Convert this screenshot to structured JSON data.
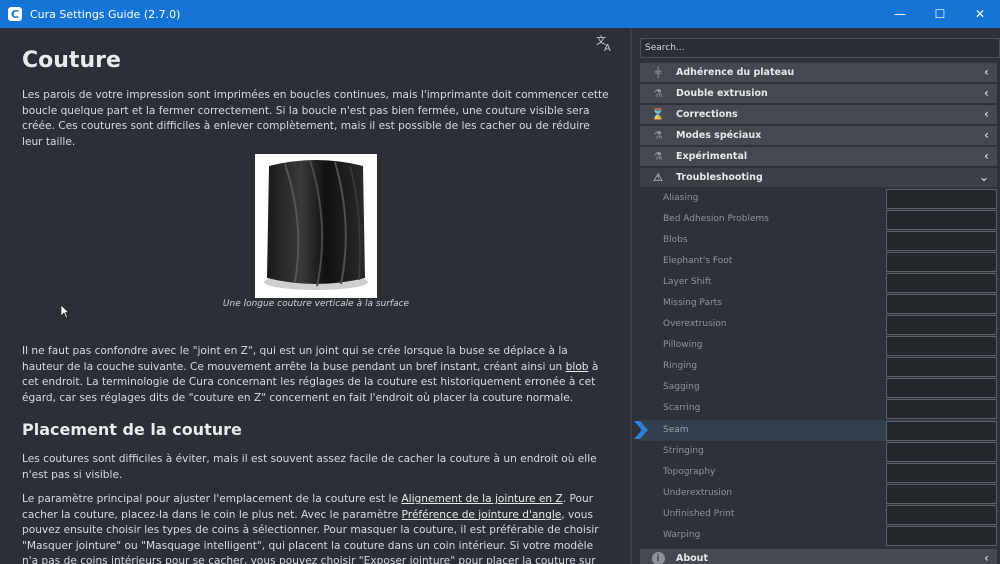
{
  "window": {
    "title": "Cura Settings Guide (2.7.0)",
    "app_icon_glyph": "C",
    "controls": {
      "minimize": "—",
      "maximize": "☐",
      "close": "✕"
    }
  },
  "article": {
    "heading": "Couture",
    "intro": "Les parois de votre impression sont imprimées en boucles continues, mais l'imprimante doit commencer cette boucle quelque part et la fermer correctement. Si la boucle n'est pas bien fermée, une couture visible sera créée. Ces coutures sont difficiles à enlever complètement, mais il est possible de les cacher ou de réduire leur taille.",
    "figure_caption": "Une longue couture verticale à la surface",
    "p2_before": "Il ne faut pas confondre avec le \"joint en Z\", qui est un joint qui se crée lorsque la buse se déplace à la hauteur de la couche suivante. Ce mouvement arrête la buse pendant un bref instant, créant ainsi un ",
    "p2_link": "blob",
    "p2_after": " à cet endroit. La terminologie de Cura concernant les réglages de la couture est historiquement erronée à cet égard, car ses réglages dits de \"couture en Z\" concernent en fait l'endroit où placer la couture normale.",
    "subheading": "Placement de la couture",
    "p3": "Les coutures sont difficiles à éviter, mais il est souvent assez facile de cacher la couture à un endroit où elle n'est pas si visible.",
    "p4_a": "Le paramètre principal pour ajuster l'emplacement de la couture est le ",
    "p4_link1": "Alignement de la jointure en Z",
    "p4_b": ". Pour cacher la couture, placez-la dans le coin le plus net. Avec le paramètre ",
    "p4_link2": "Préférence de jointure d'angle",
    "p4_c": ", vous pouvez ensuite choisir les types de coins à sélectionner. Pour masquer la couture, il est préférable de choisir \"Masquer jointure\" ou \"Masquage intelligent\", qui placent la couture dans un coin intérieur. Si votre modèle n'a pas de coins intérieurs pour se cacher, vous pouvez choisir \"Exposer jointure\" pour placer la couture sur un coin extérieur anguleux, où elle est"
  },
  "sidebar": {
    "search_placeholder": "Search...",
    "categories_top": [
      {
        "label": "Adhérence du plateau",
        "icon": "bed-adhesion-icon",
        "glyph": "╪",
        "chevron": "‹"
      },
      {
        "label": "Double extrusion",
        "icon": "dual-extrusion-icon",
        "glyph": "⚗",
        "chevron": "‹"
      },
      {
        "label": "Corrections",
        "icon": "mesh-fixes-icon",
        "glyph": "⌛",
        "chevron": "‹"
      },
      {
        "label": "Modes spéciaux",
        "icon": "special-modes-icon",
        "glyph": "⚗",
        "chevron": "‹"
      },
      {
        "label": "Expérimental",
        "icon": "experimental-icon",
        "glyph": "⚗",
        "chevron": "‹"
      }
    ],
    "troubleshooting": {
      "label": "Troubleshooting",
      "icon": "warning-icon",
      "glyph": "⚠",
      "chevron": "⌄"
    },
    "items": [
      "Aliasing",
      "Bed Adhesion Problems",
      "Blobs",
      "Elephant's Foot",
      "Layer Shift",
      "Missing Parts",
      "Overextrusion",
      "Pillowing",
      "Ringing",
      "Sagging",
      "Scarring",
      "Seam",
      "Stringing",
      "Topography",
      "Underextrusion",
      "Unfinished Print",
      "Warping"
    ],
    "selected_item": "Seam",
    "about": {
      "label": "About",
      "icon": "info-icon",
      "glyph": "i",
      "chevron": "‹"
    }
  },
  "colors": {
    "titlebar": "#1574d6",
    "background": "#2b2f36",
    "selection_marker": "#2f7fd8"
  },
  "toolbar": {
    "language_icon": "language-icon"
  }
}
